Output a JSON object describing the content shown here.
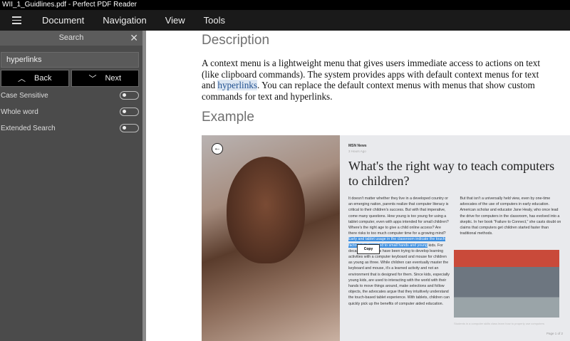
{
  "window": {
    "title": "WII_1_Guidlines.pdf - Perfect PDF Reader"
  },
  "menu": [
    "Document",
    "Navigation",
    "View",
    "Tools"
  ],
  "search": {
    "title": "Search",
    "query": "hyperlinks",
    "back": "Back",
    "next": "Next",
    "options": [
      {
        "label": "Case Sensitive",
        "on": false
      },
      {
        "label": "Whole word",
        "on": false
      },
      {
        "label": "Extended Search",
        "on": false
      }
    ]
  },
  "doc": {
    "h1": "Description",
    "p_before": "A context menu is a lightweight menu that gives users immediate access to actions on text (like clipboard commands). The system provides apps with default context menus for text and ",
    "p_hit": "hyperlinks",
    "p_after": ". You can replace the default context menus with menus that show custom commands for text and hyperlinks.",
    "h2": "Example"
  },
  "article": {
    "source": "MSN News",
    "time": "3 Hours Ago",
    "title": "What's the right way to teach computers to children?",
    "col1a": "It doesn't matter whether they live in a developed country or an emerging nation, parents realize that computer literacy is critical to their children's success. But with that imperative, come many questions. How young is too young for using a tablet computer, even with apps intended for small children? Where's the right age to give a child online access? Are there risks to too much computer time for a growing mind?",
    "col1sel": "Early and tablet usage in the classroom indicate the touch factor is better suited to small hands and young",
    "col1b": " kids. For decades, educators have been trying to develop learning activities with a computer keyboard and mouse for children as young as three. While children can eventually master the keyboard and mouse, it's a learned activity and not an environment that is designed for them. Since kids, especially young kids, are used to interacting with the world with their hands to move things around, make selections and follow objects, the advocates argue that they intuitively understand the touch-based tablet experience. With tablets, children can quickly pick up the benefits of computer aided education.",
    "col2": "But that isn't a universally held view, even by one-time advocates of the use of computers in early education. American scholar and educator Jane Healy, who once lead the drive for computers in the classroom, has evolved into a skeptic. In her book \"Failure to Connect,\" she casts doubt on claims that computers get children started faster than traditional methods.",
    "copy": "Copy",
    "caption": "Students in a computer skills class learn how to properly use computers",
    "page": "Page 1 of 2"
  }
}
